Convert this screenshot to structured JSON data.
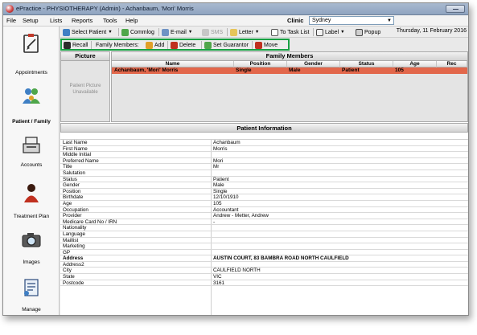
{
  "window": {
    "title": "ePractice - PHYSIOTHERAPY (Admin) - Achanbaum, 'Mori' Morris"
  },
  "menu": {
    "items": [
      "File",
      "Setup",
      "Lists",
      "Reports",
      "Tools",
      "Help"
    ],
    "clinic_label": "Clinic",
    "clinic_value": "Sydney"
  },
  "sidebar": {
    "items": [
      {
        "label": "Appointments",
        "icon": "clipboard-icon"
      },
      {
        "label": "Patient / Family",
        "icon": "people-icon"
      },
      {
        "label": "Accounts",
        "icon": "cash-register-icon"
      },
      {
        "label": "Treatment Plan",
        "icon": "person-icon"
      },
      {
        "label": "Images",
        "icon": "camera-icon"
      },
      {
        "label": "Manage",
        "icon": "document-icon"
      }
    ]
  },
  "toolbar": {
    "select_patient": "Select Patient",
    "commlog": "Commlog",
    "email": "E-mail",
    "sms": "SMS",
    "letter": "Letter",
    "to_task_list": "To Task List",
    "label": "Label",
    "popup": "Popup",
    "date": "Thursday, 11 February 2016"
  },
  "family_toolbar": {
    "recall": "Recall",
    "family_members": "Family Members:",
    "add": "Add",
    "delete": "Delete",
    "set_guarantor": "Set Guarantor",
    "move": "Move"
  },
  "picture_panel": {
    "header": "Picture",
    "placeholder": "Patient Picture Unavailable"
  },
  "family_panel": {
    "header": "Family Members",
    "columns": [
      "Name",
      "Position",
      "Gender",
      "Status",
      "Age",
      "Rec"
    ],
    "rows": [
      [
        "Achanbaum, 'Mori' Morris",
        "Single",
        "Male",
        "Patient",
        "105",
        ""
      ]
    ]
  },
  "patient_info": {
    "header": "Patient Information",
    "rows": [
      {
        "label": "Last Name",
        "value": "Achanbaum"
      },
      {
        "label": "First Name",
        "value": "Morris"
      },
      {
        "label": "Middle Initial",
        "value": ""
      },
      {
        "label": "Preferred Name",
        "value": "Mori"
      },
      {
        "label": "Title",
        "value": "Mr"
      },
      {
        "label": "Salutation",
        "value": ""
      },
      {
        "label": "Status",
        "value": "Patient"
      },
      {
        "label": "Gender",
        "value": "Male"
      },
      {
        "label": "Position",
        "value": "Single"
      },
      {
        "label": "Birthdate",
        "value": "12/10/1910"
      },
      {
        "label": "Age",
        "value": "105"
      },
      {
        "label": "Occupation",
        "value": "Accountant"
      },
      {
        "label": "Provider",
        "value": "Andrew - Metter, Andrew"
      },
      {
        "label": "Medicare Card No / IRN",
        "value": "-"
      },
      {
        "label": "Nationality",
        "value": ""
      },
      {
        "label": "Language",
        "value": ""
      },
      {
        "label": "Maillist",
        "value": ""
      },
      {
        "label": "Marketing",
        "value": ""
      },
      {
        "label": "GP",
        "value": ""
      },
      {
        "label": "Address",
        "value": "AUSTIN COURT, 83 BAMBRA ROAD NORTH CAULFIELD",
        "bold": true
      },
      {
        "label": "Address2",
        "value": ""
      },
      {
        "label": "City",
        "value": "CAULFIELD NORTH"
      },
      {
        "label": "State",
        "value": "VIC"
      },
      {
        "label": "Postcode",
        "value": "3161"
      }
    ]
  },
  "colors": {
    "selected_row": "#e2674b",
    "highlight_border": "#17a043",
    "titlebar": "#9db0c9"
  }
}
